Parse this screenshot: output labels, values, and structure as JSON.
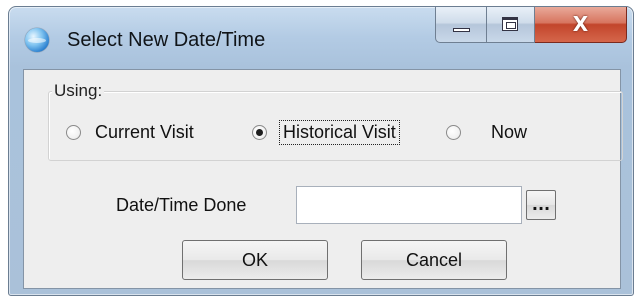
{
  "window": {
    "title": "Select New Date/Time",
    "buttons": {
      "minimize_icon": "minimize-icon",
      "maximize_icon": "maximize-icon",
      "close_glyph": "X"
    },
    "close_color": "#c2452b"
  },
  "using_group": {
    "label": "Using:",
    "options": [
      {
        "label": "Current Visit",
        "checked": false
      },
      {
        "label": "Historical Visit",
        "checked": true
      },
      {
        "label": "Now",
        "checked": false
      }
    ]
  },
  "date_time": {
    "label": "Date/Time Done",
    "value": "",
    "placeholder": "",
    "browse_label": "..."
  },
  "actions": {
    "ok_label": "OK",
    "cancel_label": "Cancel"
  }
}
